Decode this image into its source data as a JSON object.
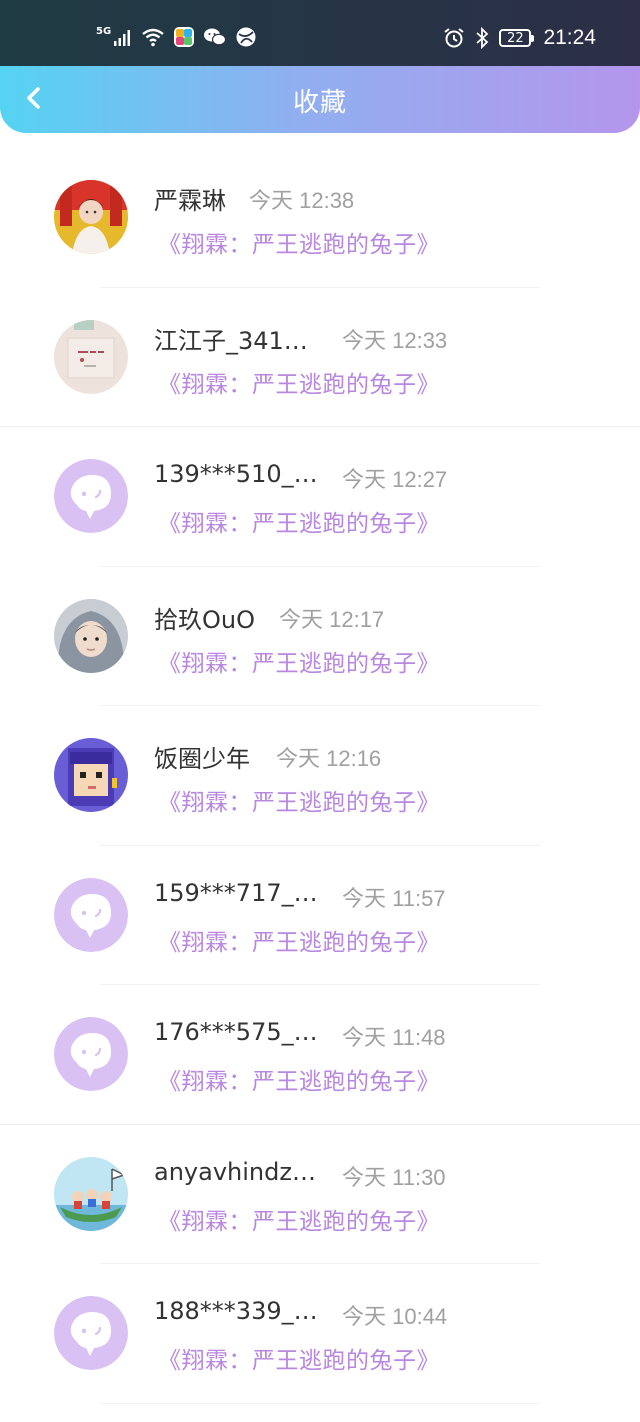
{
  "status_bar": {
    "network_label": "5G",
    "time": "21:24",
    "battery": "22",
    "icons": [
      "signal-icon",
      "wifi-icon",
      "app-icon",
      "wechat-icon",
      "browser-icon",
      "alarm-icon",
      "bluetooth-icon",
      "battery-icon"
    ]
  },
  "header": {
    "title": "收藏",
    "back_icon": "chevron-left-icon"
  },
  "colors": {
    "header_gradient": [
      "#55d3f2",
      "#b496ec"
    ],
    "title_link": "#b887e0",
    "time_text": "#a0a0a0",
    "default_avatar_bg": "#d9c1f3"
  },
  "favorites": [
    {
      "username": "严霖琳",
      "time": "今天 12:38",
      "title": "《翔霖：严王逃跑的兔子》",
      "avatar": "photo-poster"
    },
    {
      "username": "江江子_341…",
      "time": "今天 12:33",
      "title": "《翔霖：严王逃跑的兔子》",
      "avatar": "photo-sketch"
    },
    {
      "username": "139***510_…",
      "time": "今天 12:27",
      "title": "《翔霖：严王逃跑的兔子》",
      "avatar": "default-chat-icon"
    },
    {
      "username": "拾玖OuO",
      "time": "今天 12:17",
      "title": "《翔霖：严王逃跑的兔子》",
      "avatar": "photo-hood"
    },
    {
      "username": "饭圈少年",
      "time": "今天 12:16",
      "title": "《翔霖：严王逃跑的兔子》",
      "avatar": "pixel-girl"
    },
    {
      "username": "159***717_…",
      "time": "今天 11:57",
      "title": "《翔霖：严王逃跑的兔子》",
      "avatar": "default-chat-icon"
    },
    {
      "username": "176***575_…",
      "time": "今天 11:48",
      "title": "《翔霖：严王逃跑的兔子》",
      "avatar": "default-chat-icon"
    },
    {
      "username": "anyavhindz…",
      "time": "今天 11:30",
      "title": "《翔霖：严王逃跑的兔子》",
      "avatar": "cartoon-boat"
    },
    {
      "username": "188***339_…",
      "time": "今天 10:44",
      "title": "《翔霖：严王逃跑的兔子》",
      "avatar": "default-chat-icon"
    }
  ]
}
